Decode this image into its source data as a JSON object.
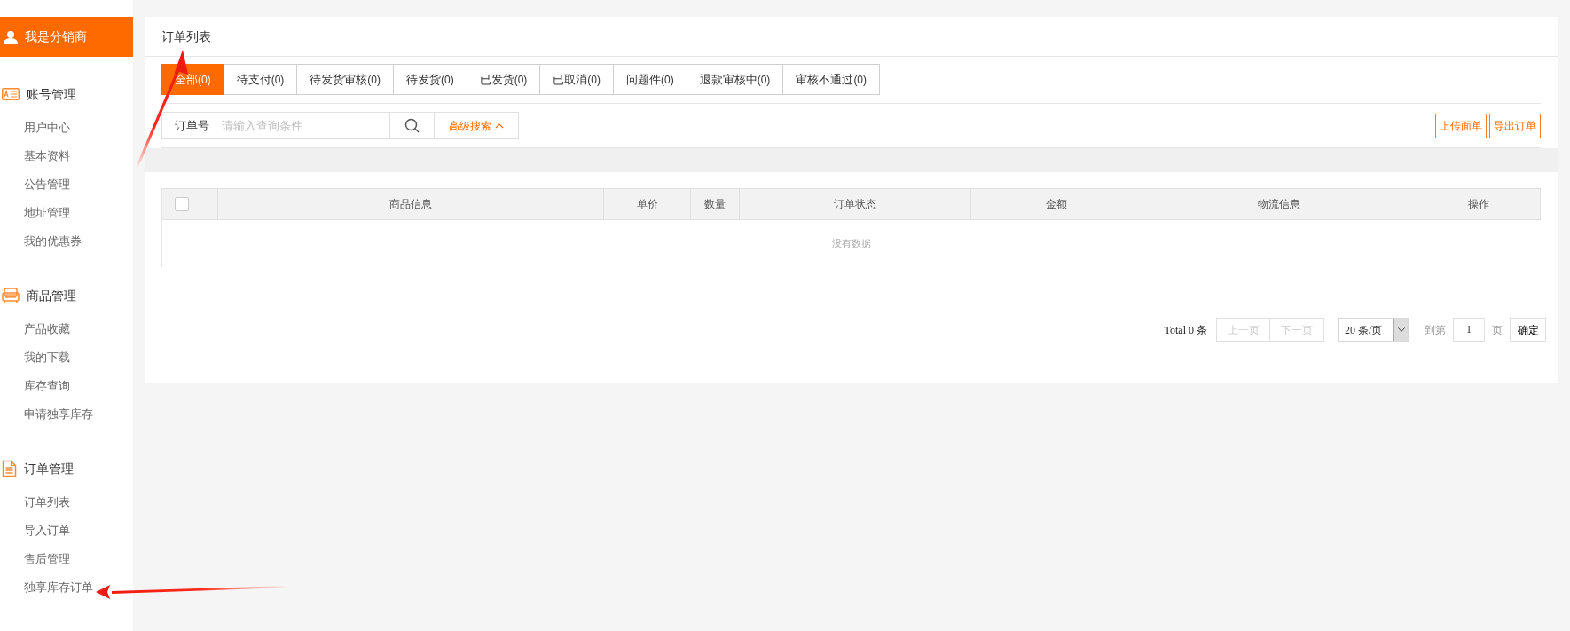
{
  "sidebar": {
    "header": "我是分销商",
    "groups": [
      {
        "kind": "account",
        "title": "账号管理",
        "items": [
          {
            "label": "用户中心"
          },
          {
            "label": "基本资料"
          },
          {
            "label": "公告管理"
          },
          {
            "label": "地址管理"
          },
          {
            "label": "我的优惠券"
          }
        ]
      },
      {
        "kind": "goods",
        "title": "商品管理",
        "items": [
          {
            "label": "产品收藏"
          },
          {
            "label": "我的下载"
          },
          {
            "label": "库存查询"
          },
          {
            "label": "申请独享库存"
          }
        ]
      },
      {
        "kind": "order",
        "title": "订单管理",
        "items": [
          {
            "label": "订单列表"
          },
          {
            "label": "导入订单"
          },
          {
            "label": "售后管理"
          },
          {
            "label": "独享库存订单"
          }
        ]
      }
    ]
  },
  "page_title": "订单列表",
  "tabs": [
    {
      "label": "全部",
      "count": "(0)",
      "selected": true
    },
    {
      "label": "待支付",
      "count": "(0)",
      "selected": false
    },
    {
      "label": "待发货审核",
      "count": "(0)",
      "selected": false
    },
    {
      "label": "待发货",
      "count": "(0)",
      "selected": false
    },
    {
      "label": "已发货",
      "count": "(0)",
      "selected": false
    },
    {
      "label": "已取消",
      "count": "(0)",
      "selected": false
    },
    {
      "label": "问题件",
      "count": "(0)",
      "selected": false
    },
    {
      "label": "退款审核中",
      "count": "(0)",
      "selected": false
    },
    {
      "label": "审核不通过",
      "count": "(0)",
      "selected": false
    }
  ],
  "search": {
    "label": "订单号",
    "placeholder": "请输入查询条件",
    "advanced": "高级搜索",
    "advanced_expanded": true
  },
  "actions": [
    "上传面单",
    "导出订单"
  ],
  "table": {
    "select_all_checked": false,
    "columns": [
      "商品信息",
      "单价",
      "数量",
      "订单状态",
      "金额",
      "物流信息",
      "操作"
    ],
    "empty_text": "没有数据"
  },
  "pagination": {
    "total": "Total 0 条",
    "prev": "上一页",
    "next": "下一页",
    "page_size": "20 条/页",
    "goto_label": "到第",
    "page": "1",
    "page_unit": "页",
    "confirm": "确定"
  }
}
